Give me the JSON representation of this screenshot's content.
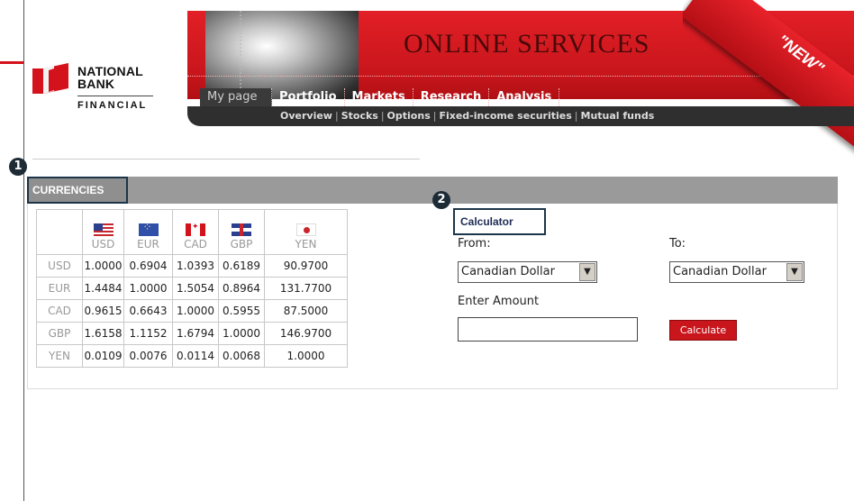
{
  "brand": {
    "logo_line1": "NATIONAL",
    "logo_line2": "BANK",
    "logo_line3": "FINANCIAL",
    "banner_title": "ONLINE SERVICES",
    "badge": "\"NEW\"",
    "colors": {
      "brand_red": "#d4121b",
      "dark_nav": "#2f2f2f",
      "section_gray": "#9a9a9a",
      "callout_navy": "#1d2b36"
    }
  },
  "nav": {
    "tabs": [
      {
        "label": "My page"
      },
      {
        "label": "Portfolio"
      },
      {
        "label": "Markets"
      },
      {
        "label": "Research"
      },
      {
        "label": "Analysis"
      }
    ],
    "sub_items": [
      "Overview",
      "Stocks",
      "Options",
      "Fixed-income securities",
      "Mutual funds"
    ]
  },
  "callouts": [
    "1",
    "2"
  ],
  "section": {
    "title": "CURRENCIES"
  },
  "currency_table": {
    "columns": [
      "USD",
      "EUR",
      "CAD",
      "GBP",
      "YEN"
    ],
    "flag_icons": [
      "usa-flag-icon",
      "eu-flag-icon",
      "canada-flag-icon",
      "uk-flag-icon",
      "japan-flag-icon"
    ],
    "rows": [
      {
        "label": "USD",
        "values": [
          "1.0000",
          "0.6904",
          "1.0393",
          "0.6189",
          "90.9700"
        ]
      },
      {
        "label": "EUR",
        "values": [
          "1.4484",
          "1.0000",
          "1.5054",
          "0.8964",
          "131.7700"
        ]
      },
      {
        "label": "CAD",
        "values": [
          "0.9615",
          "0.6643",
          "1.0000",
          "0.5955",
          "87.5000"
        ]
      },
      {
        "label": "GBP",
        "values": [
          "1.6158",
          "1.1152",
          "1.6794",
          "1.0000",
          "146.9700"
        ]
      },
      {
        "label": "YEN",
        "values": [
          "0.0109",
          "0.0076",
          "0.0114",
          "0.0068",
          "1.0000"
        ]
      }
    ]
  },
  "calculator": {
    "title": "Calculator",
    "from_label": "From:",
    "to_label": "To:",
    "from_value": "Canadian Dollar",
    "to_value": "Canadian Dollar",
    "amount_label": "Enter Amount",
    "amount_value": "",
    "button_label": "Calculate"
  }
}
